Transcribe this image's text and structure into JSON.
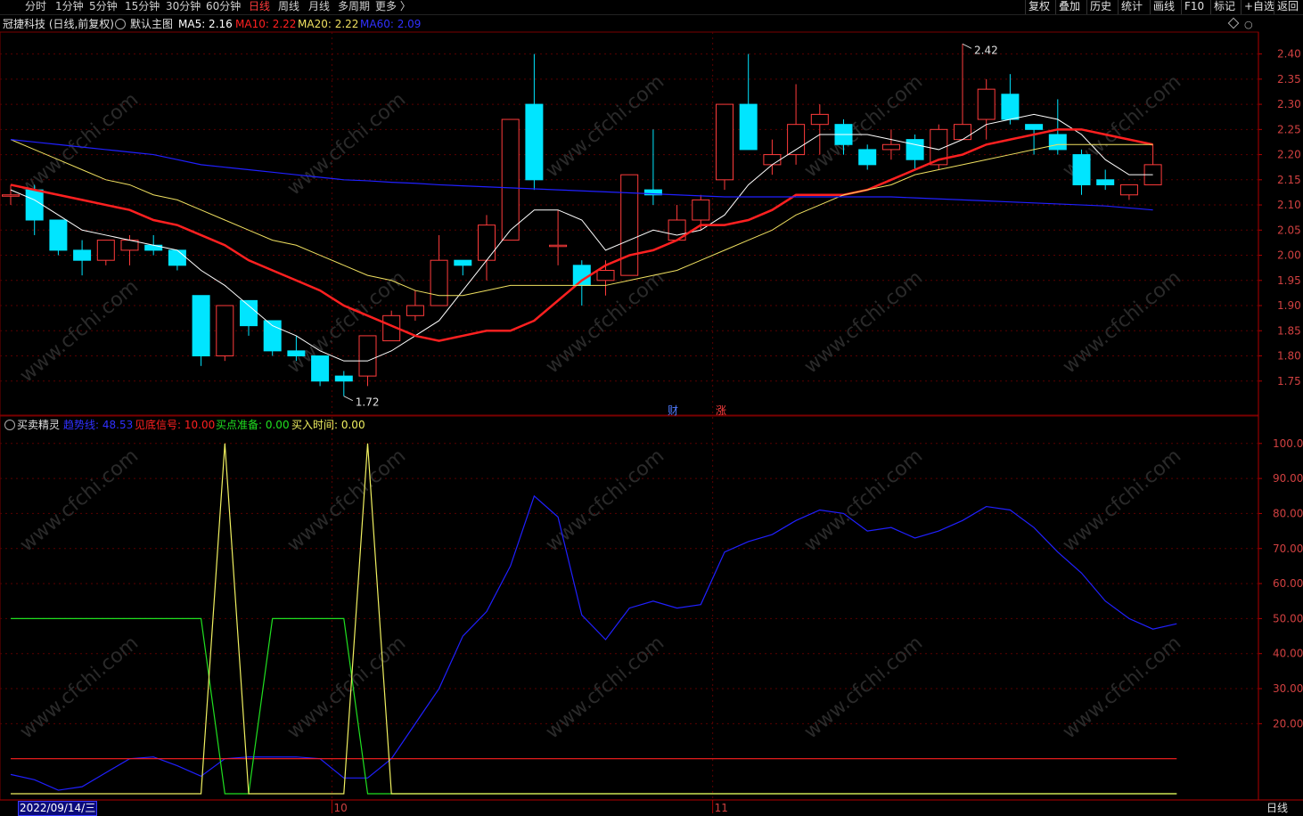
{
  "toolbar": {
    "periods": [
      {
        "label": "分时",
        "active": false
      },
      {
        "label": "1分钟",
        "active": false
      },
      {
        "label": "5分钟",
        "active": false
      },
      {
        "label": "15分钟",
        "active": false
      },
      {
        "label": "30分钟",
        "active": false
      },
      {
        "label": "60分钟",
        "active": false
      },
      {
        "label": "日线",
        "active": true
      },
      {
        "label": "周线",
        "active": false
      },
      {
        "label": "月线",
        "active": false
      },
      {
        "label": "多周期",
        "active": false
      },
      {
        "label": "更多 〉",
        "active": false
      }
    ],
    "right": [
      "复权",
      "叠加",
      "历史",
      "统计",
      "画线",
      "F10",
      "标记",
      "+自选",
      "返回"
    ]
  },
  "legend_main": {
    "stock": "冠捷科技 (日线,前复权)",
    "template": "默认主图",
    "ma5": "MA5: 2.16",
    "ma10": "MA10: 2.22",
    "ma20": "MA20: 2.22",
    "ma60": "MA60: 2.09"
  },
  "legend_sub": {
    "name": "买卖精灵",
    "l1": "趋势线: 48.53",
    "l2": "见底信号: 10.00",
    "l3": "买点准备: 0.00",
    "l4": "买入时间: 0.00"
  },
  "markers": {
    "high": "2.42",
    "low": "1.72",
    "cai": "财",
    "zhang": "涨"
  },
  "date_cursor": "2022/09/14/三",
  "period_label": "日线",
  "watermark": "www.cfchi.com",
  "colors": {
    "up": "#ff3b3b",
    "down": "#00e5ff",
    "ma5": "#ffffff",
    "ma10": "#ff2020",
    "ma20": "#f0e060",
    "ma60": "#2020ff",
    "trend": "#2020ff",
    "bottom": "#ff2020",
    "prep": "#20e020",
    "buy": "#f0f060"
  },
  "chart_data": [
    {
      "type": "candlestick",
      "title": "冠捷科技 (日线,前复权)",
      "ylim": [
        1.7,
        2.44
      ],
      "yticks": [
        1.75,
        1.8,
        1.85,
        1.9,
        1.95,
        2.0,
        2.05,
        2.1,
        2.15,
        2.2,
        2.25,
        2.3,
        2.35,
        2.4
      ],
      "x_labels": [
        {
          "index": 14,
          "label": "10"
        },
        {
          "index": 30,
          "label": "11"
        }
      ],
      "candles": [
        {
          "o": 2.12,
          "h": 2.14,
          "l": 2.1,
          "c": 2.12
        },
        {
          "o": 2.13,
          "h": 2.14,
          "l": 2.04,
          "c": 2.07
        },
        {
          "o": 2.07,
          "h": 2.07,
          "l": 2.0,
          "c": 2.01
        },
        {
          "o": 2.01,
          "h": 2.03,
          "l": 1.96,
          "c": 1.99
        },
        {
          "o": 1.99,
          "h": 2.03,
          "l": 1.98,
          "c": 2.03
        },
        {
          "o": 2.01,
          "h": 2.04,
          "l": 1.98,
          "c": 2.03
        },
        {
          "o": 2.02,
          "h": 2.04,
          "l": 2.0,
          "c": 2.01
        },
        {
          "o": 2.01,
          "h": 2.01,
          "l": 1.97,
          "c": 1.98
        },
        {
          "o": 1.92,
          "h": 1.92,
          "l": 1.78,
          "c": 1.8
        },
        {
          "o": 1.8,
          "h": 1.9,
          "l": 1.79,
          "c": 1.9
        },
        {
          "o": 1.91,
          "h": 1.91,
          "l": 1.84,
          "c": 1.86
        },
        {
          "o": 1.87,
          "h": 1.87,
          "l": 1.8,
          "c": 1.81
        },
        {
          "o": 1.81,
          "h": 1.84,
          "l": 1.79,
          "c": 1.8
        },
        {
          "o": 1.8,
          "h": 1.8,
          "l": 1.74,
          "c": 1.75
        },
        {
          "o": 1.76,
          "h": 1.77,
          "l": 1.72,
          "c": 1.75
        },
        {
          "o": 1.76,
          "h": 1.84,
          "l": 1.74,
          "c": 1.84
        },
        {
          "o": 1.83,
          "h": 1.89,
          "l": 1.83,
          "c": 1.88
        },
        {
          "o": 1.88,
          "h": 1.93,
          "l": 1.87,
          "c": 1.9
        },
        {
          "o": 1.9,
          "h": 2.04,
          "l": 1.9,
          "c": 1.99
        },
        {
          "o": 1.99,
          "h": 1.99,
          "l": 1.96,
          "c": 1.98
        },
        {
          "o": 1.99,
          "h": 2.08,
          "l": 1.95,
          "c": 2.06
        },
        {
          "o": 2.03,
          "h": 2.27,
          "l": 2.03,
          "c": 2.27
        },
        {
          "o": 2.3,
          "h": 2.4,
          "l": 2.13,
          "c": 2.15
        },
        {
          "o": 2.02,
          "h": 2.09,
          "l": 1.98,
          "c": 2.02
        },
        {
          "o": 1.98,
          "h": 1.99,
          "l": 1.9,
          "c": 1.94
        },
        {
          "o": 1.95,
          "h": 1.99,
          "l": 1.92,
          "c": 1.97
        },
        {
          "o": 1.96,
          "h": 2.16,
          "l": 1.96,
          "c": 2.16
        },
        {
          "o": 2.13,
          "h": 2.25,
          "l": 2.1,
          "c": 2.12
        },
        {
          "o": 2.03,
          "h": 2.1,
          "l": 2.03,
          "c": 2.07
        },
        {
          "o": 2.07,
          "h": 2.12,
          "l": 2.05,
          "c": 2.11
        },
        {
          "o": 2.15,
          "h": 2.3,
          "l": 2.13,
          "c": 2.3
        },
        {
          "o": 2.3,
          "h": 2.4,
          "l": 2.21,
          "c": 2.21
        },
        {
          "o": 2.18,
          "h": 2.23,
          "l": 2.16,
          "c": 2.2
        },
        {
          "o": 2.2,
          "h": 2.34,
          "l": 2.18,
          "c": 2.26
        },
        {
          "o": 2.26,
          "h": 2.3,
          "l": 2.2,
          "c": 2.28
        },
        {
          "o": 2.26,
          "h": 2.27,
          "l": 2.2,
          "c": 2.22
        },
        {
          "o": 2.21,
          "h": 2.22,
          "l": 2.17,
          "c": 2.18
        },
        {
          "o": 2.21,
          "h": 2.25,
          "l": 2.19,
          "c": 2.22
        },
        {
          "o": 2.23,
          "h": 2.24,
          "l": 2.17,
          "c": 2.19
        },
        {
          "o": 2.18,
          "h": 2.26,
          "l": 2.17,
          "c": 2.25
        },
        {
          "o": 2.23,
          "h": 2.42,
          "l": 2.23,
          "c": 2.26
        },
        {
          "o": 2.27,
          "h": 2.35,
          "l": 2.23,
          "c": 2.33
        },
        {
          "o": 2.32,
          "h": 2.36,
          "l": 2.26,
          "c": 2.27
        },
        {
          "o": 2.26,
          "h": 2.26,
          "l": 2.2,
          "c": 2.25
        },
        {
          "o": 2.24,
          "h": 2.31,
          "l": 2.2,
          "c": 2.21
        },
        {
          "o": 2.2,
          "h": 2.21,
          "l": 2.12,
          "c": 2.14
        },
        {
          "o": 2.15,
          "h": 2.17,
          "l": 2.13,
          "c": 2.14
        },
        {
          "o": 2.12,
          "h": 2.14,
          "l": 2.11,
          "c": 2.14
        },
        {
          "o": 2.14,
          "h": 2.22,
          "l": 2.14,
          "c": 2.18
        }
      ],
      "series": [
        {
          "name": "MA5",
          "values": [
            2.13,
            2.11,
            2.08,
            2.05,
            2.04,
            2.03,
            2.02,
            2.01,
            1.97,
            1.94,
            1.9,
            1.86,
            1.84,
            1.81,
            1.79,
            1.79,
            1.81,
            1.84,
            1.87,
            1.93,
            1.99,
            2.05,
            2.09,
            2.09,
            2.07,
            2.01,
            2.03,
            2.05,
            2.04,
            2.05,
            2.08,
            2.14,
            2.18,
            2.21,
            2.24,
            2.24,
            2.24,
            2.23,
            2.22,
            2.21,
            2.23,
            2.26,
            2.27,
            2.28,
            2.27,
            2.24,
            2.19,
            2.16,
            2.16
          ]
        },
        {
          "name": "MA10",
          "values": [
            2.14,
            2.13,
            2.12,
            2.11,
            2.1,
            2.09,
            2.07,
            2.06,
            2.04,
            2.02,
            1.99,
            1.97,
            1.95,
            1.93,
            1.9,
            1.88,
            1.86,
            1.84,
            1.83,
            1.84,
            1.85,
            1.85,
            1.87,
            1.91,
            1.95,
            1.98,
            2.0,
            2.01,
            2.03,
            2.06,
            2.06,
            2.07,
            2.09,
            2.12,
            2.12,
            2.12,
            2.13,
            2.15,
            2.17,
            2.19,
            2.2,
            2.22,
            2.23,
            2.24,
            2.25,
            2.25,
            2.24,
            2.23,
            2.22
          ]
        },
        {
          "name": "MA20",
          "values": [
            2.23,
            2.21,
            2.19,
            2.17,
            2.15,
            2.14,
            2.12,
            2.11,
            2.09,
            2.07,
            2.05,
            2.03,
            2.02,
            2.0,
            1.98,
            1.96,
            1.95,
            1.93,
            1.92,
            1.92,
            1.93,
            1.94,
            1.94,
            1.94,
            1.94,
            1.94,
            1.95,
            1.96,
            1.97,
            1.99,
            2.01,
            2.03,
            2.05,
            2.08,
            2.1,
            2.12,
            2.13,
            2.14,
            2.16,
            2.17,
            2.18,
            2.19,
            2.2,
            2.21,
            2.22,
            2.22,
            2.22,
            2.22,
            2.22
          ]
        },
        {
          "name": "MA60",
          "values": [
            2.23,
            2.225,
            2.22,
            2.215,
            2.21,
            2.205,
            2.2,
            2.19,
            2.18,
            2.175,
            2.17,
            2.165,
            2.16,
            2.155,
            2.15,
            2.148,
            2.145,
            2.143,
            2.14,
            2.138,
            2.136,
            2.134,
            2.132,
            2.13,
            2.128,
            2.126,
            2.124,
            2.122,
            2.12,
            2.118,
            2.116,
            2.116,
            2.116,
            2.116,
            2.116,
            2.116,
            2.116,
            2.116,
            2.114,
            2.112,
            2.11,
            2.108,
            2.106,
            2.104,
            2.102,
            2.1,
            2.098,
            2.094,
            2.09
          ]
        }
      ]
    },
    {
      "type": "line",
      "title": "买卖精灵",
      "ylim": [
        0,
        103
      ],
      "yticks": [
        20,
        30,
        40,
        50,
        60,
        70,
        80,
        90,
        100
      ],
      "series": [
        {
          "name": "趋势线",
          "values": [
            5.5,
            4.0,
            1.0,
            2.0,
            6.0,
            10.0,
            10.5,
            8.0,
            5.0,
            10.0,
            10.5,
            10.5,
            10.5,
            10.0,
            4.5,
            4.5,
            10.0,
            20.0,
            30.0,
            45.0,
            52.0,
            65.0,
            85.0,
            79.0,
            51.0,
            44.0,
            53.0,
            55.0,
            53.0,
            54.0,
            69.0,
            72.0,
            74.0,
            78.0,
            81.0,
            80.0,
            75.0,
            76.0,
            73.0,
            75.0,
            78.0,
            82.0,
            81.0,
            76.0,
            69.0,
            63.0,
            55.0,
            50.0,
            47.0,
            48.53
          ]
        },
        {
          "name": "见底信号",
          "values": [
            10,
            10,
            10,
            10,
            10,
            10,
            10,
            10,
            10,
            10,
            10,
            10,
            10,
            10,
            10,
            10,
            10,
            10,
            10,
            10,
            10,
            10,
            10,
            10,
            10,
            10,
            10,
            10,
            10,
            10,
            10,
            10,
            10,
            10,
            10,
            10,
            10,
            10,
            10,
            10,
            10,
            10,
            10,
            10,
            10,
            10,
            10,
            10,
            10,
            10
          ]
        },
        {
          "name": "买点准备",
          "values": [
            50,
            50,
            50,
            50,
            50,
            50,
            50,
            50,
            50,
            0,
            0,
            50,
            50,
            50,
            50,
            0,
            0,
            0,
            0,
            0,
            0,
            0,
            0,
            0,
            0,
            0,
            0,
            0,
            0,
            0,
            0,
            0,
            0,
            0,
            0,
            0,
            0,
            0,
            0,
            0,
            0,
            0,
            0,
            0,
            0,
            0,
            0,
            0,
            0,
            0
          ]
        },
        {
          "name": "买入时间",
          "values": [
            0,
            0,
            0,
            0,
            0,
            0,
            0,
            0,
            0,
            100,
            0,
            0,
            0,
            0,
            0,
            100,
            0,
            0,
            0,
            0,
            0,
            0,
            0,
            0,
            0,
            0,
            0,
            0,
            0,
            0,
            0,
            0,
            0,
            0,
            0,
            0,
            0,
            0,
            0,
            0,
            0,
            0,
            0,
            0,
            0,
            0,
            0,
            0,
            0,
            0
          ]
        }
      ]
    }
  ]
}
